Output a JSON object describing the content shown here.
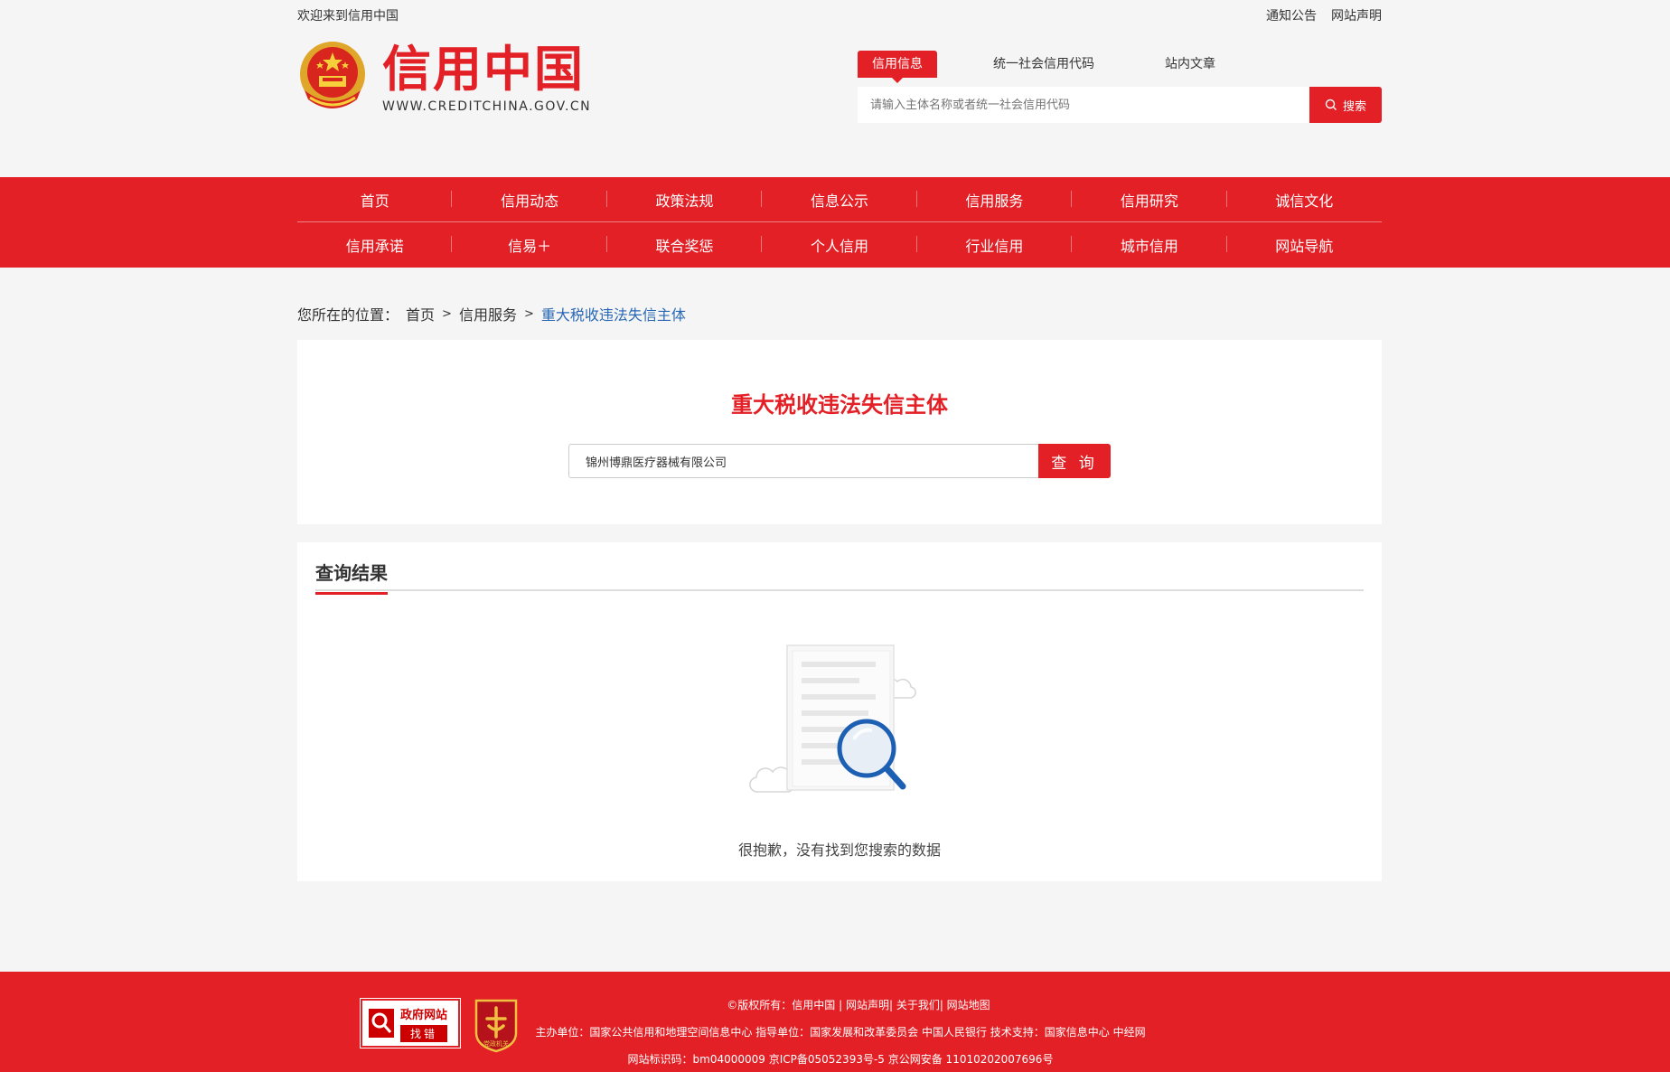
{
  "top_bar": {
    "welcome": "欢迎来到信用中国",
    "links": [
      "通知公告",
      "网站声明"
    ]
  },
  "logo": {
    "cn": "信用中国",
    "en": "WWW.CREDITCHINA.GOV.CN"
  },
  "search": {
    "tabs": [
      "信用信息",
      "统一社会信用代码",
      "站内文章"
    ],
    "active_tab": "信用信息",
    "placeholder": "请输入主体名称或者统一社会信用代码",
    "button": "搜索"
  },
  "nav": {
    "row1": [
      "首页",
      "信用动态",
      "政策法规",
      "信息公示",
      "信用服务",
      "信用研究",
      "诚信文化"
    ],
    "row2": [
      "信用承诺",
      "信易＋",
      "联合奖惩",
      "个人信用",
      "行业信用",
      "城市信用",
      "网站导航"
    ]
  },
  "breadcrumb": {
    "prefix": "您所在的位置：",
    "home": "首页",
    "sep": ">",
    "parent": "信用服务",
    "current": "重大税收违法失信主体"
  },
  "query": {
    "title": "重大税收违法失信主体",
    "value": "锦州博鼎医疗器械有限公司",
    "button": "查 询"
  },
  "result": {
    "heading": "查询结果",
    "empty_text": "很抱歉，没有找到您搜索的数据"
  },
  "footer": {
    "gov_badge_top": "政府网站",
    "gov_badge_bottom": "找错",
    "party_badge": "党政机关",
    "line1": "©版权所有：信用中国 | 网站声明| 关于我们| 网站地图",
    "line2": "主办单位：国家公共信用和地理空间信息中心    指导单位：国家发展和改革委员会 中国人民银行    技术支持：国家信息中心 中经网",
    "line3": "网站标识码：bm04000009 京ICP备05052393号-5  京公网安备 11010202007696号"
  },
  "colors": {
    "brand_red": "#e22026",
    "link_blue": "#2867b4"
  }
}
